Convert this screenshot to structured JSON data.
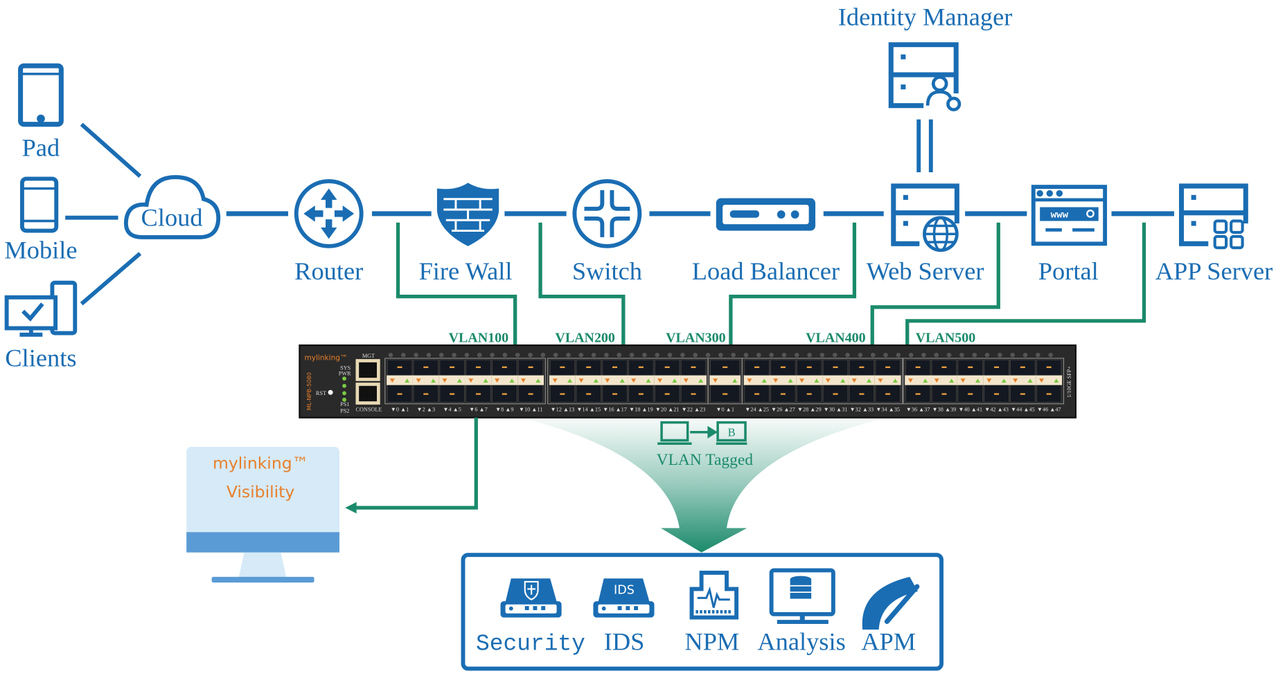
{
  "colors": {
    "blue": "#1a6db3",
    "green": "#1b8a6b",
    "orange": "#e8802a",
    "switch_body": "#2a2a2a",
    "screen": "#d6eaf8",
    "screen_band": "#5b9bd5"
  },
  "top": {
    "identity_manager": "Identity Manager"
  },
  "clients": {
    "pad": "Pad",
    "mobile": "Mobile",
    "clients": "Clients"
  },
  "chain": {
    "cloud": "Cloud",
    "router": "Router",
    "firewall": "Fire Wall",
    "switch": "Switch",
    "load_balancer": "Load Balancer",
    "web_server": "Web Server",
    "portal": "Portal",
    "app_server": "APP Server"
  },
  "portal_icon": {
    "url_text": "www"
  },
  "vlans": [
    "VLAN100",
    "VLAN200",
    "VLAN300",
    "VLAN400",
    "VLAN500"
  ],
  "device": {
    "brand": "mylinking™",
    "model": "ML-NPB-5080",
    "mgt": "MGT",
    "sys": "SYS",
    "pwr": "PWR",
    "rst": "RST",
    "ps1": "PS1",
    "ps2": "PS2",
    "console": "CONSOLE",
    "port_type": "1/10GE SFP+",
    "port_labels": [
      [
        "▼0 ▲1",
        "▼2 ▲3",
        "▼4 ▲5",
        "▼6 ▲7",
        "▼8 ▲9",
        "▼10 ▲11"
      ],
      [
        "▼12 ▲13",
        "▼14 ▲15",
        "▼16 ▲17",
        "▼18 ▲19",
        "▼20 ▲21",
        "▼22 ▲23"
      ],
      [
        "▼0 ▲1"
      ],
      [
        "▼24 ▲25",
        "▼26 ▲27",
        "▼28 ▲29",
        "▼30 ▲31",
        "▼32 ▲33",
        "▼34 ▲35"
      ],
      [
        "▼36 ▲37",
        "▼38 ▲39",
        "▼40 ▲41",
        "▼42 ▲43",
        "▼44 ▲45",
        "▼46 ▲47"
      ]
    ]
  },
  "vlan_tagged": {
    "label": "VLAN Tagged",
    "badge": "B"
  },
  "monitor": {
    "line1": "mylinking™",
    "line2": "Visibility"
  },
  "tools": {
    "ids_badge": "IDS",
    "items": [
      "Security",
      "IDS",
      "NPM",
      "Analysis",
      "APM"
    ]
  }
}
